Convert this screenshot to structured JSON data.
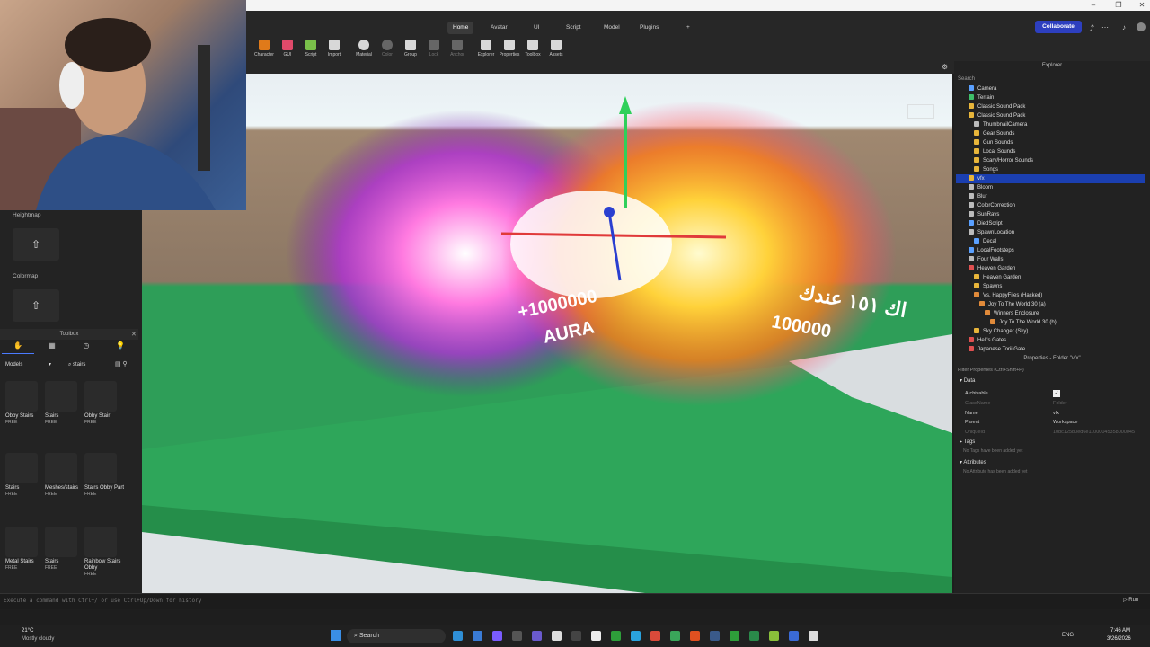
{
  "ribbon": {
    "tabs": [
      "Home",
      "Avatar",
      "UI",
      "Script",
      "Model",
      "Plugins",
      "+"
    ],
    "active_tab": "Home",
    "collaborate_label": "Collaborate",
    "tools": [
      "Character",
      "GUI",
      "Script",
      "Import",
      "Material",
      "Color",
      "Group",
      "Lock",
      "Anchor",
      "Explorer",
      "Properties",
      "Toolbox",
      "Assets"
    ]
  },
  "left_panel": {
    "heightmap_label": "Heightmap",
    "colormap_label": "Colormap"
  },
  "toolbox": {
    "title": "Toolbox",
    "category": "Models",
    "search_value": "stairs",
    "items": [
      {
        "name": "Obby Stairs",
        "price": "FREE"
      },
      {
        "name": "Stairs",
        "price": "FREE"
      },
      {
        "name": "Obby Stair",
        "price": "FREE"
      },
      {
        "name": "Stairs",
        "price": "FREE"
      },
      {
        "name": "Meshes/stairs",
        "price": "FREE"
      },
      {
        "name": "Stairs Obby Part",
        "price": "FREE"
      },
      {
        "name": "Metal Stairs",
        "price": "FREE"
      },
      {
        "name": "Stairs",
        "price": "FREE"
      },
      {
        "name": "Rainbow Stairs Obby",
        "price": "FREE"
      }
    ]
  },
  "viewport": {
    "billboard_left_line1": "+1000000",
    "billboard_left_line2": "AURA",
    "billboard_right_line1": "اك ١٥١ عندك",
    "billboard_right_line2": "100000"
  },
  "explorer": {
    "title": "Explorer",
    "search_placeholder": "Search",
    "items": [
      {
        "label": "Camera",
        "color": "#5aa0ff"
      },
      {
        "label": "Terrain",
        "color": "#3fbf6a"
      },
      {
        "label": "Classic Sound Pack",
        "color": "#e8b53a"
      },
      {
        "label": "Classic Sound Pack",
        "color": "#e8b53a"
      },
      {
        "label": "ThumbnailCamera",
        "color": "#bbbbbb"
      },
      {
        "label": "Gear Sounds",
        "color": "#e8b53a"
      },
      {
        "label": "Gun Sounds",
        "color": "#e8b53a"
      },
      {
        "label": "Local Sounds",
        "color": "#e8b53a"
      },
      {
        "label": "Scary/Horror Sounds",
        "color": "#e8b53a"
      },
      {
        "label": "Songs",
        "color": "#e8b53a"
      },
      {
        "label": "vfx",
        "color": "#e8b53a"
      },
      {
        "label": "Bloom",
        "color": "#bbbbbb"
      },
      {
        "label": "Blur",
        "color": "#bbbbbb"
      },
      {
        "label": "ColorCorrection",
        "color": "#bbbbbb"
      },
      {
        "label": "SunRays",
        "color": "#bbbbbb"
      },
      {
        "label": "DiedScript",
        "color": "#5aa0ff"
      },
      {
        "label": "SpawnLocation",
        "color": "#bbbbbb"
      },
      {
        "label": "Decal",
        "color": "#5aa0ff"
      },
      {
        "label": "LocalFootsteps",
        "color": "#5aa0ff"
      },
      {
        "label": "Four Walls",
        "color": "#bbbbbb"
      },
      {
        "label": "Heaven Garden",
        "color": "#e05050"
      },
      {
        "label": "Heaven Garden",
        "color": "#e8b53a"
      },
      {
        "label": "Spawns",
        "color": "#e8b53a"
      },
      {
        "label": "Vs. HappyFiles (Hacked)",
        "color": "#e08a3a"
      },
      {
        "label": "Joy To The World 30 (a)",
        "color": "#e08a3a"
      },
      {
        "label": "Winners Enclosure",
        "color": "#e08a3a"
      },
      {
        "label": "Joy To The World 30 (b)",
        "color": "#e08a3a"
      },
      {
        "label": "Sky Changer (Sky)",
        "color": "#e8b53a"
      },
      {
        "label": "Hell's Gates",
        "color": "#e05050"
      },
      {
        "label": "Japanese Torii Gate",
        "color": "#e05050"
      }
    ]
  },
  "properties": {
    "title": "Properties - Folder \"vfx\"",
    "filter_placeholder": "Filter Properties (Ctrl+Shift+P)",
    "section_data": "Data",
    "rows": [
      {
        "key": "Archivable",
        "value": "✓"
      },
      {
        "key": "ClassName",
        "value": "Folder"
      },
      {
        "key": "Name",
        "value": "vfx"
      },
      {
        "key": "Parent",
        "value": "Workspace"
      },
      {
        "key": "UniqueId",
        "value": "10bc125b0ed6e11000045358000045"
      }
    ],
    "section_tags": "Tags",
    "tags_empty": "No Tags have been added yet",
    "section_attributes": "Attributes",
    "attributes_empty": "No Attribute has been added yet"
  },
  "command_bar": {
    "placeholder": "Execute a command with Ctrl+/ or use Ctrl+Up/Down for history",
    "run_label": "Run"
  },
  "taskbar": {
    "weather_temp": "21°C",
    "weather_desc": "Mostly cloudy",
    "search_label": "Search",
    "language": "ENG",
    "time": "7:46 AM",
    "date": "3/26/2026"
  }
}
